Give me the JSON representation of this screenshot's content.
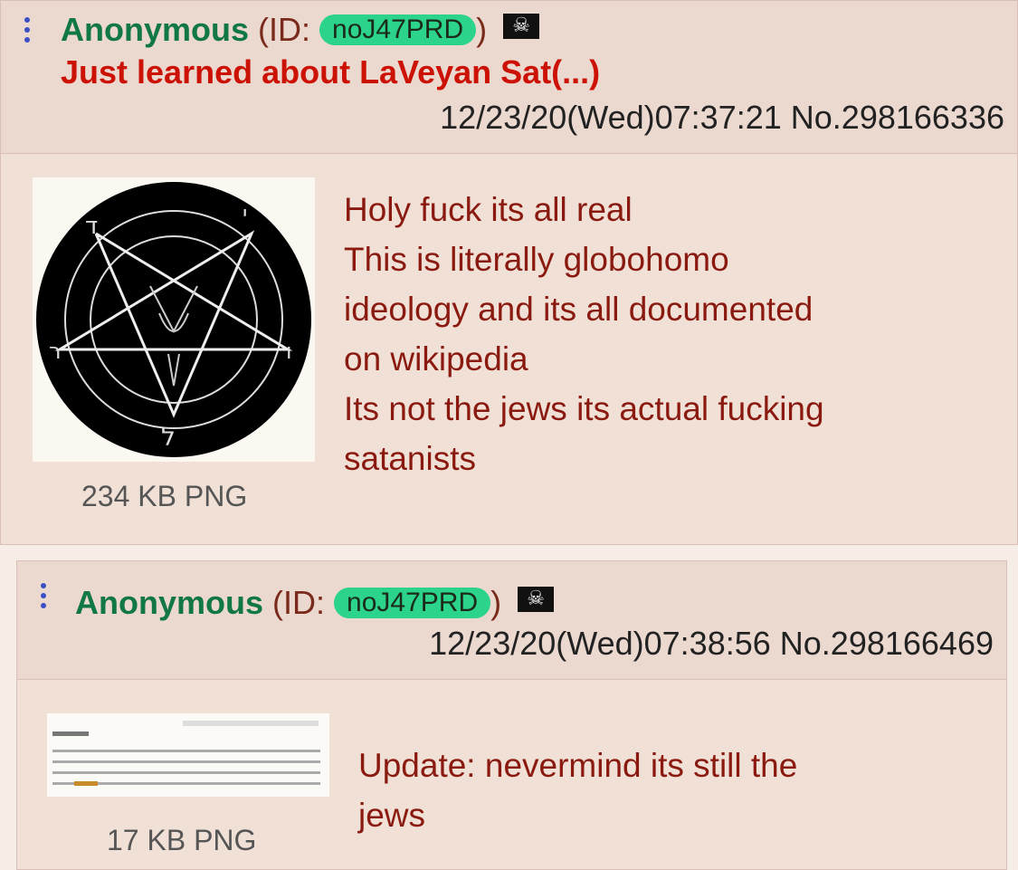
{
  "posts": [
    {
      "name": "Anonymous",
      "id_prefix": "(ID:",
      "id": "noJ47PRD",
      "id_suffix": ")",
      "flag_icon": "pirate-flag-icon",
      "subject": "Just learned about LaVeyan Sat(...)",
      "datetime": "12/23/20(Wed)07:37:21",
      "number": "No.298166336",
      "file_size": "234 KB PNG",
      "thumbnail": "sigil-of-baphomet-pentagram",
      "comment_lines": [
        "Holy fuck its all real",
        "This is literally globohomo",
        "ideology and its all documented",
        "on wikipedia",
        "Its not the jews its actual fucking",
        "satanists"
      ]
    },
    {
      "name": "Anonymous",
      "id_prefix": "(ID:",
      "id": "noJ47PRD",
      "id_suffix": ")",
      "flag_icon": "pirate-flag-icon",
      "datetime": "12/23/20(Wed)07:38:56",
      "number": "No.298166469",
      "file_size": "17 KB PNG",
      "thumbnail": "wikipedia-text-screenshot",
      "comment_lines": [
        "Update: nevermind its still the",
        "jews"
      ]
    }
  ],
  "colors": {
    "post_bg": "#f0e0d6",
    "name": "#117743",
    "subject": "#cc1105",
    "id_pill": "#2bd48a",
    "comment": "#8a1a10"
  }
}
